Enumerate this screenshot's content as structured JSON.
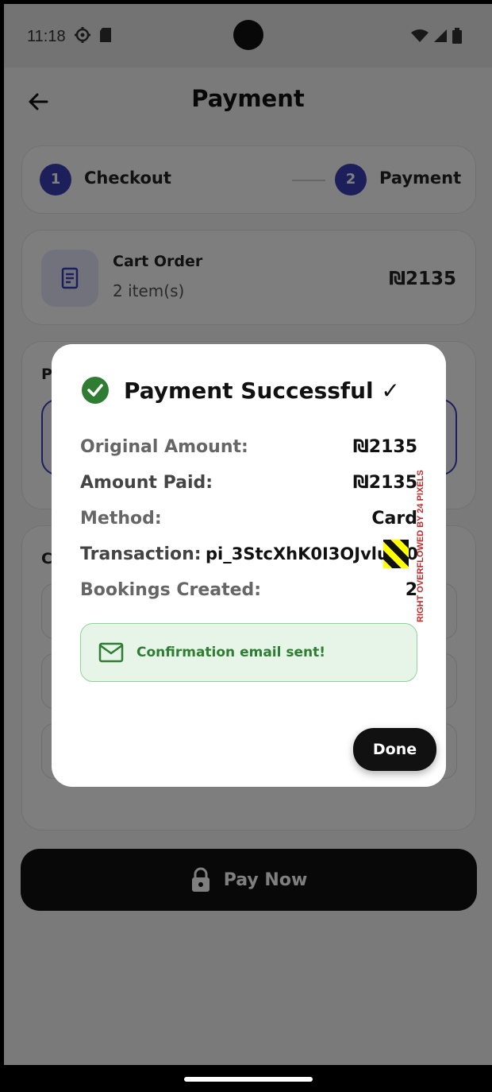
{
  "status_bar": {
    "time": "11:18"
  },
  "header": {
    "title": "Payment"
  },
  "stepper": {
    "step1": {
      "number": "1",
      "label": "Checkout"
    },
    "step2": {
      "number": "2",
      "label": "Payment"
    }
  },
  "cart": {
    "title": "Cart Order",
    "subtitle": "2 item(s)",
    "price": "₪2135"
  },
  "background_labels": {
    "section3": "P",
    "section4": "C"
  },
  "pay_button": {
    "label": "Pay Now"
  },
  "dialog": {
    "title": "Payment Successful ✓",
    "rows": [
      {
        "key": "Original Amount:",
        "value": "₪2135"
      },
      {
        "key": "Amount Paid:",
        "value": "₪2135"
      },
      {
        "key": "Method:",
        "value": "Card"
      },
      {
        "key": "Transaction:",
        "value": "pi_3StcXhK0I3OJvlu/80"
      },
      {
        "key": "Bookings Created:",
        "value": "2"
      }
    ],
    "email_notice": "Confirmation email sent!",
    "done_label": "Done",
    "overflow_warning": "RIGHT OVERFLOWED BY 24 PIXELS"
  },
  "colors": {
    "accent": "#3b3fb5",
    "success": "#2e7d32",
    "success_bg": "#e6f5e7"
  }
}
